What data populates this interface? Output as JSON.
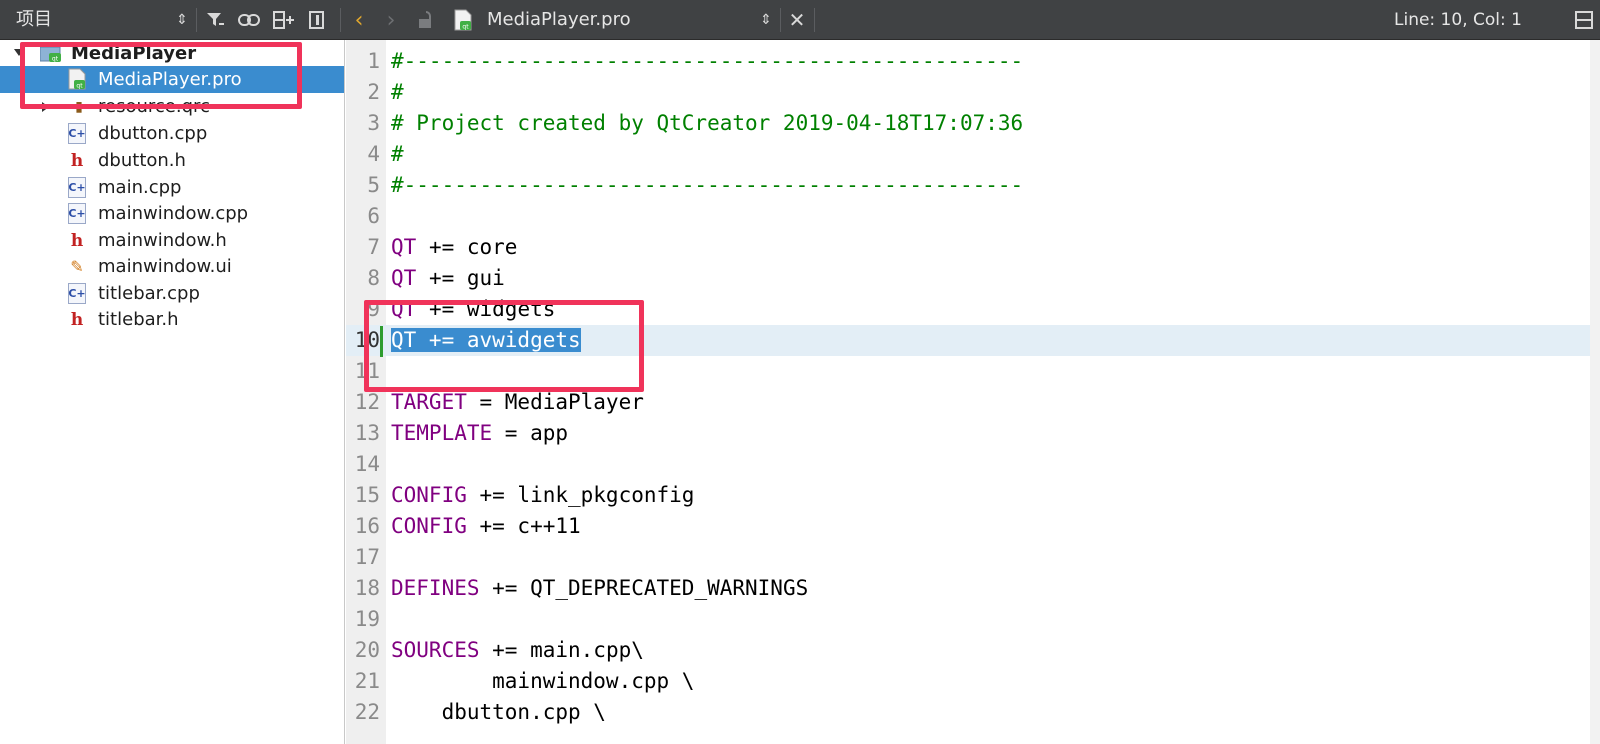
{
  "sidebar_header": {
    "title": "项目",
    "icons": [
      "sort-icon",
      "filter-icon",
      "link-icon",
      "split-icon",
      "close-sidebar-icon"
    ]
  },
  "editor_toolbar": {
    "file_name": "MediaPlayer.pro",
    "position": "Line: 10, Col: 1"
  },
  "project_tree": {
    "root": "MediaPlayer",
    "items": [
      {
        "label": "MediaPlayer.pro",
        "icon": "pro-file-icon",
        "selected": true
      },
      {
        "label": "resource.qrc",
        "icon": "qrc-file-icon",
        "selected": false
      },
      {
        "label": "dbutton.cpp",
        "icon": "cpp-file-icon",
        "selected": false
      },
      {
        "label": "dbutton.h",
        "icon": "header-file-icon",
        "selected": false
      },
      {
        "label": "main.cpp",
        "icon": "cpp-file-icon",
        "selected": false
      },
      {
        "label": "mainwindow.cpp",
        "icon": "cpp-file-icon",
        "selected": false
      },
      {
        "label": "mainwindow.h",
        "icon": "header-file-icon",
        "selected": false
      },
      {
        "label": "mainwindow.ui",
        "icon": "ui-file-icon",
        "selected": false
      },
      {
        "label": "titlebar.cpp",
        "icon": "cpp-file-icon",
        "selected": false
      },
      {
        "label": "titlebar.h",
        "icon": "header-file-icon",
        "selected": false
      }
    ]
  },
  "code": {
    "current_line": 10,
    "lines": [
      {
        "n": "1",
        "text": "#-------------------------------------------------"
      },
      {
        "n": "2",
        "text": "#"
      },
      {
        "n": "3",
        "text": "# Project created by QtCreator 2019-04-18T17:07:36"
      },
      {
        "n": "4",
        "text": "#"
      },
      {
        "n": "5",
        "text": "#-------------------------------------------------"
      },
      {
        "n": "6",
        "text": ""
      },
      {
        "n": "7",
        "kw": "QT",
        "rest": " += core"
      },
      {
        "n": "8",
        "kw": "QT",
        "rest": " += gui"
      },
      {
        "n": "9",
        "kw": "QT",
        "rest": " += widgets"
      },
      {
        "n": "10",
        "text": "QT += avwidgets"
      },
      {
        "n": "11",
        "text": ""
      },
      {
        "n": "12",
        "kw": "TARGET",
        "rest": " = MediaPlayer"
      },
      {
        "n": "13",
        "kw": "TEMPLATE",
        "rest": " = app"
      },
      {
        "n": "14",
        "text": ""
      },
      {
        "n": "15",
        "kw": "CONFIG",
        "rest": " += link_pkgconfig"
      },
      {
        "n": "16",
        "kw": "CONFIG",
        "rest": " += c++11"
      },
      {
        "n": "17",
        "text": ""
      },
      {
        "n": "18",
        "kw": "DEFINES",
        "rest": " += QT_DEPRECATED_WARNINGS"
      },
      {
        "n": "19",
        "text": ""
      },
      {
        "n": "20",
        "kw": "SOURCES",
        "rest": " += main.cpp\\"
      },
      {
        "n": "21",
        "text": "        mainwindow.cpp \\"
      },
      {
        "n": "22",
        "text": "    dbutton.cpp \\"
      }
    ]
  },
  "colors": {
    "toolbar_bg": "#404244",
    "selection": "#3a8ccf",
    "comment": "#008000",
    "keyword": "#800080",
    "annotation": "#f0335a"
  }
}
